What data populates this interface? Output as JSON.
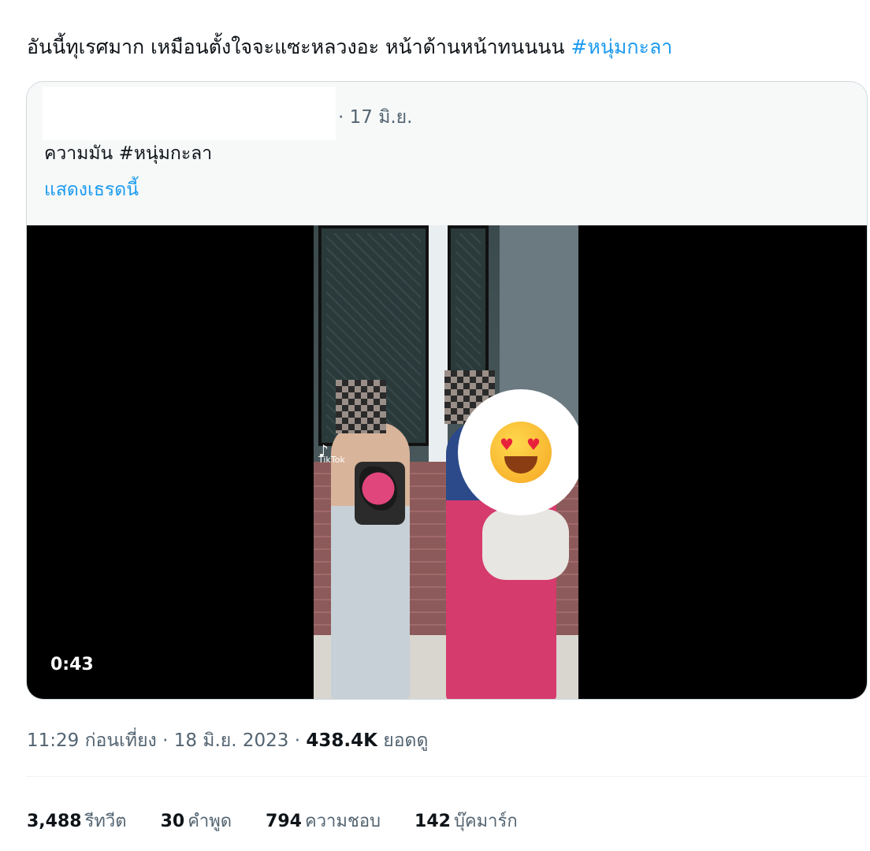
{
  "tweet": {
    "text": "อันนี้ทุเรศมาก เหมือนตั้งใจจะแซะหลวงอะ หน้าด้านหน้าทนนนน ",
    "hashtag": "#หนุ่มกะลา"
  },
  "quote": {
    "date": "· 17 มิ.ย.",
    "text": "ความมัน  #หนุ่มกะลา",
    "show_thread": "แสดงเธรดนี้"
  },
  "video": {
    "duration": "0:43",
    "watermark": "TikTok"
  },
  "meta": {
    "time_date": "11:29 ก่อนเที่ยง · 18 มิ.ย. 2023 · ",
    "views_count": "438.4K",
    "views_label": " ยอดดู"
  },
  "stats": {
    "retweets_count": "3,488",
    "retweets_label": "รีทวีต",
    "quotes_count": "30",
    "quotes_label": "คำพูด",
    "likes_count": "794",
    "likes_label": "ความชอบ",
    "bookmarks_count": "142",
    "bookmarks_label": "บุ๊คมาร์ก"
  },
  "colors": {
    "link": "#1d9bf0",
    "text": "#0f1419",
    "secondary": "#536471"
  }
}
